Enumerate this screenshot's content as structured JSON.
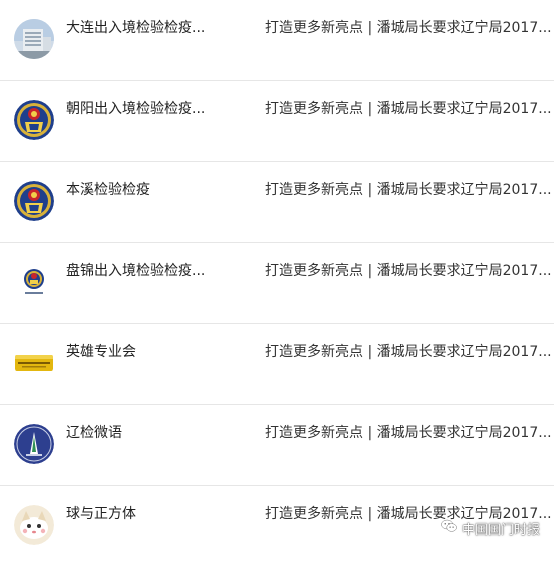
{
  "accounts": [
    {
      "name": "大连出入境检验检疫...",
      "article": "打造更多新亮点 | 潘城局长要求辽宁局2017...",
      "avatar_icon": "building-photo-icon"
    },
    {
      "name": "朝阳出入境检验检疫...",
      "article": "打造更多新亮点 | 潘城局长要求辽宁局2017...",
      "avatar_icon": "ciq-emblem-icon"
    },
    {
      "name": "本溪检验检疫",
      "article": "打造更多新亮点 | 潘城局长要求辽宁局2017...",
      "avatar_icon": "ciq-emblem-icon"
    },
    {
      "name": "盘锦出入境检验检疫...",
      "article": "打造更多新亮点 | 潘城局长要求辽宁局2017...",
      "avatar_icon": "ciq-emblem-small-icon"
    },
    {
      "name": "英雄专业会",
      "article": "打造更多新亮点 | 潘城局长要求辽宁局2017...",
      "avatar_icon": "gold-card-icon"
    },
    {
      "name": "辽检微语",
      "article": "打造更多新亮点 | 潘城局长要求辽宁局2017...",
      "avatar_icon": "liaojian-logo-icon"
    },
    {
      "name": "球与正方体",
      "article": "打造更多新亮点 | 潘城局长要求辽宁局2017...",
      "avatar_icon": "cartoon-cat-icon"
    }
  ],
  "watermark": {
    "text": "中国国门时报",
    "icon": "wechat-icon"
  }
}
